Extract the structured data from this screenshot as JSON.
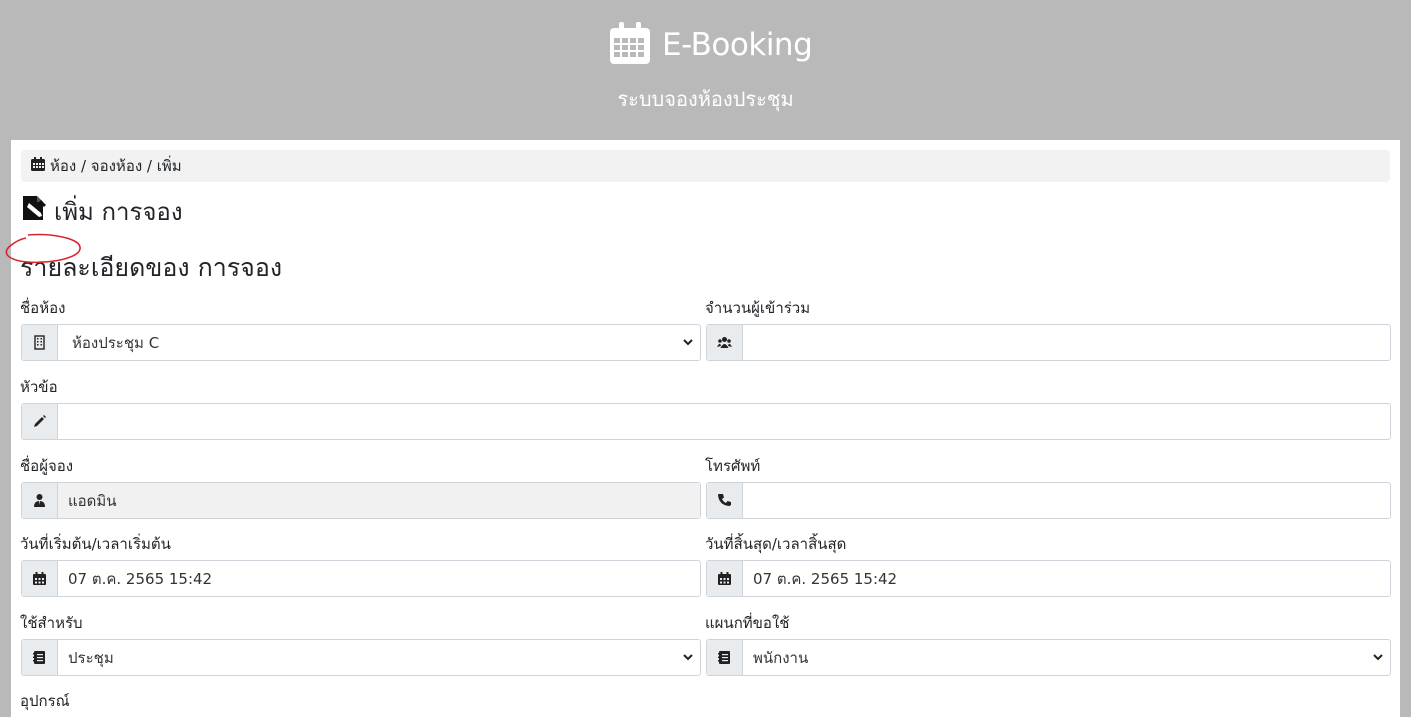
{
  "header": {
    "brand_title": "E-Booking",
    "subtitle": "ระบบจองห้องประชุม",
    "brand_icon": "calendar-icon"
  },
  "breadcrumb": {
    "text": "ห้อง / จองห้อง / เพิ่ม",
    "icon": "calendar-icon"
  },
  "page": {
    "title": "เพิ่ม การจอง",
    "title_icon": "file-signature-icon",
    "section_title": "รายละเอียดของ การจอง"
  },
  "form": {
    "room": {
      "label": "ชื่อห้อง",
      "value": "ห้องประชุม C",
      "icon": "building-icon"
    },
    "attendees": {
      "label": "จำนวนผู้เข้าร่วม",
      "value": "",
      "icon": "users-icon"
    },
    "topic": {
      "label": "หัวข้อ",
      "value": "",
      "icon": "pencil-icon"
    },
    "booker": {
      "label": "ชื่อผู้จอง",
      "value": "แอดมิน",
      "icon": "user-tie-icon"
    },
    "phone": {
      "label": "โทรศัพท์",
      "value": "",
      "icon": "phone-icon"
    },
    "start": {
      "label": "วันที่เริ่มต้น/เวลาเริ่มต้น",
      "value": "07 ต.ค. 2565 15:42",
      "icon": "calendar-icon"
    },
    "end": {
      "label": "วันที่สิ้นสุด/เวลาสิ้นสุด",
      "value": "07 ต.ค. 2565 15:42",
      "icon": "calendar-icon"
    },
    "purpose": {
      "label": "ใช้สำหรับ",
      "value": "ประชุม",
      "icon": "address-book-icon"
    },
    "department": {
      "label": "แผนกที่ขอใช้",
      "value": "พนักงาน",
      "icon": "address-book-icon"
    },
    "equipment": {
      "label": "อุปกรณ์"
    }
  },
  "colors": {
    "header_bg": "#b9b9b9",
    "addon_bg": "#e9ecef",
    "annotation": "#d9262c"
  }
}
